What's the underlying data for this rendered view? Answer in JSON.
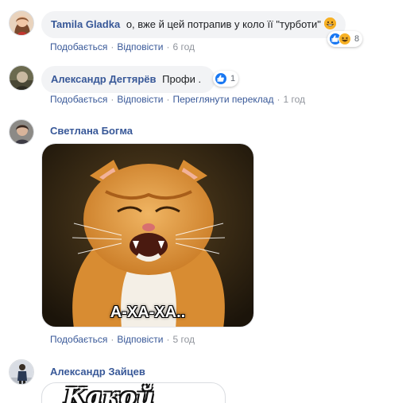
{
  "comments": [
    {
      "author": "Tamila Gladka",
      "text": "о, вже й цей потрапив у коло її \"турботи\"",
      "actions": {
        "like": "Подобається",
        "reply": "Відповісти",
        "time": "6 год"
      },
      "reactions": {
        "count": "8",
        "icons": [
          "like-reaction-icon",
          "haha-reaction-icon"
        ]
      }
    },
    {
      "author": "Александр Дегтярёв",
      "text": "Профи .",
      "actions": {
        "like": "Подобається",
        "reply": "Відповісти",
        "translate": "Переглянути переклад",
        "time": "1 год"
      },
      "reactions": {
        "count": "1",
        "icons": [
          "like-reaction-icon"
        ]
      }
    },
    {
      "author": "Светлана Богма",
      "image_caption": "А-ХА-ХА..",
      "actions": {
        "like": "Подобається",
        "reply": "Відповісти",
        "time": "5 год"
      }
    },
    {
      "author": "Александр Зайцев",
      "sticker_text": "Какой"
    }
  ],
  "colors": {
    "link": "#385898",
    "meta": "#90949c",
    "bubble": "#f2f3f5",
    "like": "#1877f2",
    "haha": "#f7b125"
  }
}
